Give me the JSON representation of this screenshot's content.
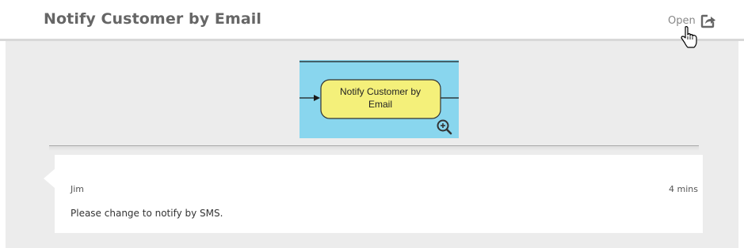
{
  "header": {
    "title": "Notify Customer by Email",
    "open_label": "Open",
    "open_icon": "share-icon"
  },
  "diagram": {
    "task_label_line1": "Notify Customer by",
    "task_label_line2": "Email",
    "zoom_icon": "zoom-in-icon",
    "background_color": "#89d6ee",
    "task_fill_color": "#f4f07a"
  },
  "comment": {
    "author": "Jim",
    "time": "4 mins",
    "text": "Please change to notify by SMS."
  },
  "cursor_icon": "hand-pointer-icon"
}
